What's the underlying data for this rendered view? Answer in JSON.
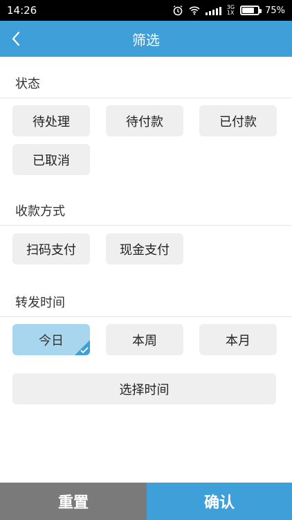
{
  "status_bar": {
    "time": "14:26",
    "network": "3G",
    "network_sub": "1X",
    "battery": "75%"
  },
  "header": {
    "title": "筛选"
  },
  "sections": {
    "status": {
      "label": "状态",
      "options": [
        "待处理",
        "待付款",
        "已付款",
        "已取消"
      ]
    },
    "payment": {
      "label": "收款方式",
      "options": [
        "扫码支付",
        "现金支付"
      ]
    },
    "forward_time": {
      "label": "转发时间",
      "options": [
        "今日",
        "本周",
        "本月"
      ],
      "selected": "今日",
      "custom_label": "选择时间"
    }
  },
  "footer": {
    "reset_label": "重置",
    "confirm_label": "确认"
  },
  "colors": {
    "accent": "#3f9fd9",
    "selected_chip": "#a8d6ef",
    "chip": "#efefef",
    "reset": "#7a7a7a"
  }
}
